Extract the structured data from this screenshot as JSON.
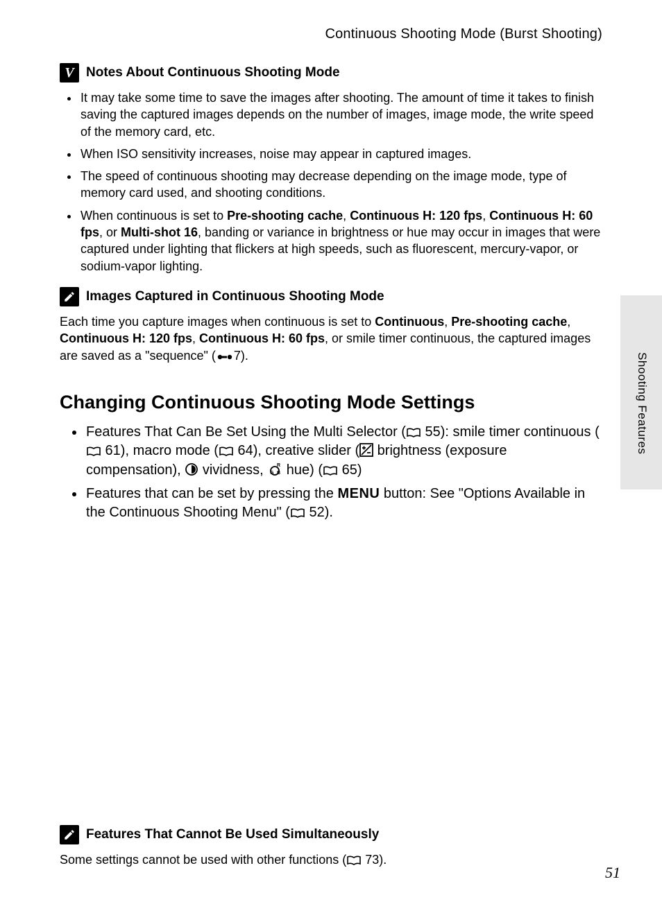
{
  "running_head": "Continuous Shooting Mode (Burst Shooting)",
  "notes": {
    "title": "Notes About Continuous Shooting Mode",
    "items": [
      "It may take some time to save the images after shooting. The amount of time it takes to finish saving the captured images depends on the number of images, image mode, the write speed of the memory card, etc.",
      "When ISO sensitivity increases, noise may appear in captured images.",
      "The speed of continuous shooting may decrease depending on the image mode, type of memory card used, and shooting conditions."
    ],
    "item4_pre": "When continuous is set to ",
    "b1": "Pre-shooting cache",
    "b2": "Continuous H: 120 fps",
    "b3": "Continuous H: 60 fps",
    "b4": "Multi-shot 16",
    "item4_mid": ", banding or variance in brightness or hue may occur in images that were captured under lighting that flickers at high speeds, such as fluorescent, mercury-vapor, or sodium-vapor lighting.",
    "or_txt": ", or "
  },
  "capture": {
    "title": "Images Captured in Continuous Shooting Mode",
    "p_pre": "Each time you capture images when continuous is set to ",
    "c1": "Continuous",
    "c2": "Pre-shooting cache",
    "c3": "Continuous H: 120 fps",
    "c4": "Continuous H: 60 fps",
    "p_mid": ", or smile timer continuous, the captured images are saved as a \"sequence\" (",
    "ref": "7).",
    "comma": ", "
  },
  "changing": {
    "title": "Changing Continuous Shooting Mode Settings",
    "li1_a": "Features That Can Be Set Using the Multi Selector (",
    "li1_a_ref": " 55): smile timer continuous (",
    "li1_b_ref": " 61), macro mode (",
    "li1_c_ref": " 64), creative slider (",
    "li1_d": " brightness (exposure compensation), ",
    "li1_e": " vividness, ",
    "li1_f": " hue) (",
    "li1_g_ref": " 65)",
    "li2_a": "Features that can be set by pressing the ",
    "menu": "MENU",
    "li2_b": " button: See \"Options Available in the Continuous Shooting Menu\" (",
    "li2_ref": " 52)."
  },
  "bottom": {
    "title": "Features That Cannot Be Used Simultaneously",
    "text_a": "Some settings cannot be used with other functions (",
    "text_ref": " 73)."
  },
  "side_label": "Shooting Features",
  "page_number": "51"
}
